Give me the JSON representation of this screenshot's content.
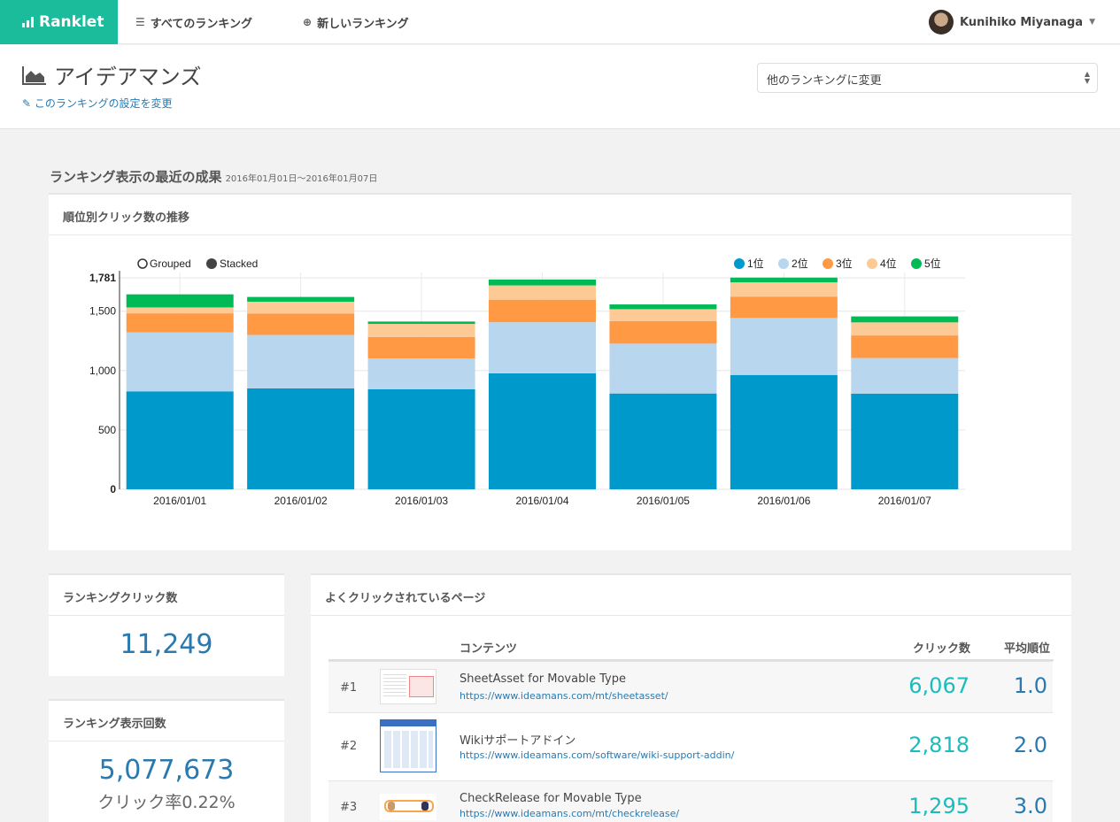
{
  "nav": {
    "brand": "Ranklet",
    "all_rankings": "すべてのランキング",
    "new_ranking": "新しいランキング",
    "user_name": "Kunihiko Miyanaga"
  },
  "header": {
    "title": "アイデアマンズ",
    "edit_link": "このランキングの設定を変更",
    "select_label": "他のランキングに変更"
  },
  "section": {
    "title": "ランキング表示の最近の成果",
    "date_range": "2016年01月01日〜2016年01月07日"
  },
  "chart_panel": {
    "title": "順位別クリック数の推移",
    "mode_grouped": "Grouped",
    "mode_stacked": "Stacked"
  },
  "colors": {
    "r1": "#0099cc",
    "r2": "#b8d6ee",
    "r3": "#ff9944",
    "r4": "#fdc994",
    "r5": "#00bb55",
    "accent": "#1abc9c"
  },
  "chart_data": {
    "type": "bar",
    "stacked": true,
    "categories": [
      "2016/01/01",
      "2016/01/02",
      "2016/01/03",
      "2016/01/04",
      "2016/01/05",
      "2016/01/06",
      "2016/01/07"
    ],
    "series": [
      {
        "name": "1位",
        "color": "#0099cc",
        "values": [
          825,
          850,
          843,
          977,
          807,
          963,
          806
        ]
      },
      {
        "name": "2位",
        "color": "#b8d6ee",
        "values": [
          497,
          450,
          260,
          430,
          420,
          480,
          300
        ]
      },
      {
        "name": "3位",
        "color": "#ff9944",
        "values": [
          160,
          180,
          180,
          190,
          190,
          180,
          190
        ]
      },
      {
        "name": "4位",
        "color": "#fdc994",
        "values": [
          50,
          100,
          110,
          120,
          100,
          120,
          110
        ]
      },
      {
        "name": "5位",
        "color": "#00bb55",
        "values": [
          110,
          40,
          20,
          50,
          40,
          40,
          50
        ]
      }
    ],
    "yticks": [
      "1,781",
      "1,500",
      "1,000",
      "500",
      "0"
    ],
    "ylim": [
      0,
      1781
    ],
    "legend_position": "top-right"
  },
  "stats": {
    "click_title": "ランキングクリック数",
    "click_value": "11,249",
    "imp_title": "ランキング表示回数",
    "imp_value": "5,077,673",
    "ctr": "クリック率0.22%"
  },
  "pages": {
    "title": "よくクリックされているページ",
    "col_content": "コンテンツ",
    "col_clicks": "クリック数",
    "col_avg": "平均順位",
    "rows": [
      {
        "rank": "#1",
        "title": "SheetAsset for Movable Type",
        "url": "https://www.ideamans.com/mt/sheetasset/",
        "clicks": "6,067",
        "avg": "1.0"
      },
      {
        "rank": "#2",
        "title": "Wikiサポートアドイン",
        "url": "https://www.ideamans.com/software/wiki-support-addin/",
        "clicks": "2,818",
        "avg": "2.0"
      },
      {
        "rank": "#3",
        "title": "CheckRelease for Movable Type",
        "url": "https://www.ideamans.com/mt/checkrelease/",
        "clicks": "1,295",
        "avg": "3.0"
      }
    ]
  }
}
